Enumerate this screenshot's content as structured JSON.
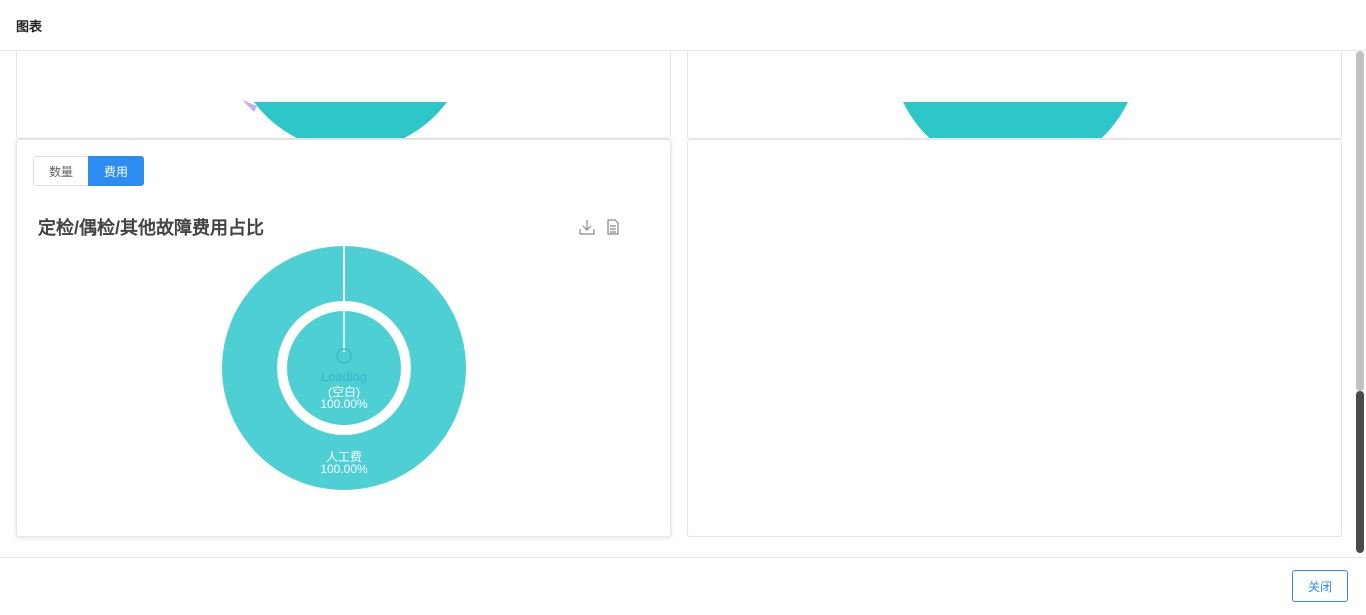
{
  "dialog": {
    "title": "图表",
    "close_label": "关闭"
  },
  "top_panels": {
    "left_accent_color": "#2ec7c9",
    "left_slice_color": "#b6a2de",
    "right_accent_color": "#2ec7c9"
  },
  "chart_panel": {
    "segmented": [
      "数量",
      "费用"
    ],
    "selected": "费用",
    "title": "定检/偶检/其他故障费用占比",
    "tools": [
      "download-icon",
      "data-view-icon"
    ]
  },
  "chart_data": {
    "type": "pie",
    "title": "定检/偶检/其他故障费用占比",
    "rings": [
      {
        "name": "outer",
        "slices": [
          {
            "label": "人工费",
            "percent": "100.00%",
            "value": 100,
            "color": "#4ecfd4"
          }
        ]
      },
      {
        "name": "inner",
        "slices": [
          {
            "label": "(空白)",
            "percent": "100.00%",
            "value": 100,
            "color": "#4ecfd4"
          }
        ]
      }
    ],
    "loading_text": "Loading"
  }
}
